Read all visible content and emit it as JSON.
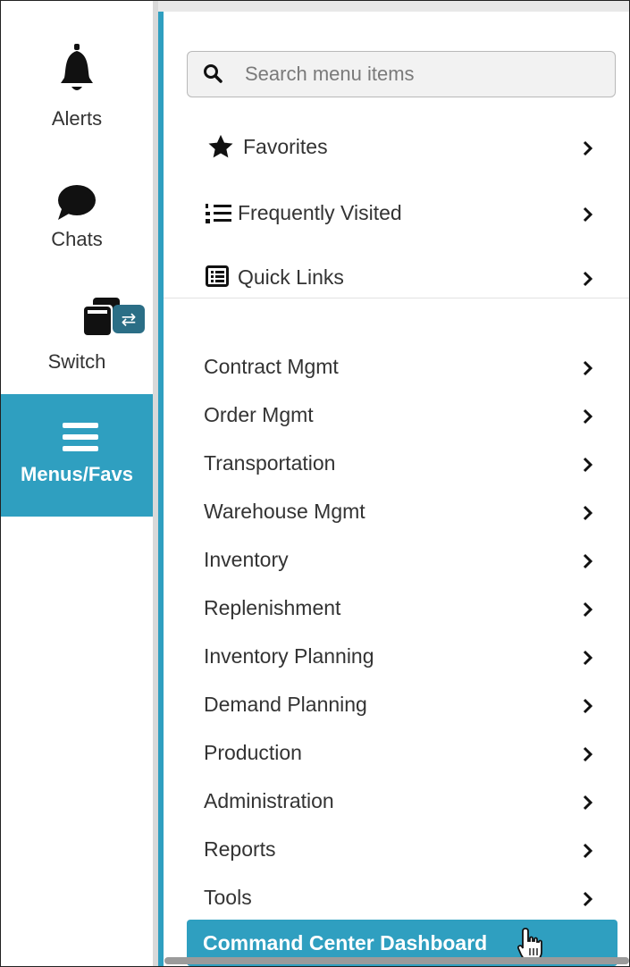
{
  "rail": {
    "alerts": {
      "label": "Alerts",
      "icon": "bell-icon"
    },
    "chats": {
      "label": "Chats",
      "icon": "chat-bubble-icon"
    },
    "switch": {
      "label": "Switch",
      "icon": "windows-stack-icon",
      "badge_icon": "swap-icon"
    },
    "menus": {
      "label": "Menus/Favs",
      "icon": "hamburger-icon"
    }
  },
  "search": {
    "placeholder": "Search menu items",
    "icon": "search-icon"
  },
  "shortcuts": [
    {
      "label": "Favorites",
      "icon": "star-icon"
    },
    {
      "label": "Frequently Visited",
      "icon": "numbered-list-icon"
    },
    {
      "label": "Quick Links",
      "icon": "list-box-icon"
    }
  ],
  "menu": [
    {
      "label": "Contract Mgmt"
    },
    {
      "label": "Order Mgmt"
    },
    {
      "label": "Transportation"
    },
    {
      "label": "Warehouse Mgmt"
    },
    {
      "label": "Inventory"
    },
    {
      "label": "Replenishment"
    },
    {
      "label": "Inventory Planning"
    },
    {
      "label": "Demand Planning"
    },
    {
      "label": "Production"
    },
    {
      "label": "Administration"
    },
    {
      "label": "Reports"
    },
    {
      "label": "Tools"
    }
  ],
  "active_item": {
    "label": "Command Center Dashboard",
    "cursor_icon": "hand-pointer-icon"
  },
  "colors": {
    "accent": "#2f9fc0",
    "badge": "#2b6e86"
  }
}
